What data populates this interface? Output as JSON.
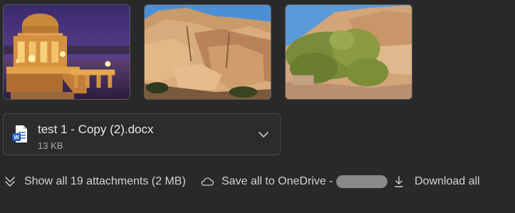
{
  "attachments": {
    "thumbnails": [
      {
        "icon": "palace-at-night-image"
      },
      {
        "icon": "rock-formation-image"
      },
      {
        "icon": "desert-shrub-image"
      }
    ],
    "file": {
      "icon": "word-document-icon",
      "name": "test 1 - Copy (2).docx",
      "size": "13 KB"
    },
    "actions": {
      "show_all": "Show all 19 attachments (2 MB)",
      "save_all": "Save all to OneDrive -",
      "download_all": "Download all"
    }
  },
  "colors": {
    "background": "#292929",
    "word_blue": "#185abd",
    "text": "#d6d6d6"
  }
}
